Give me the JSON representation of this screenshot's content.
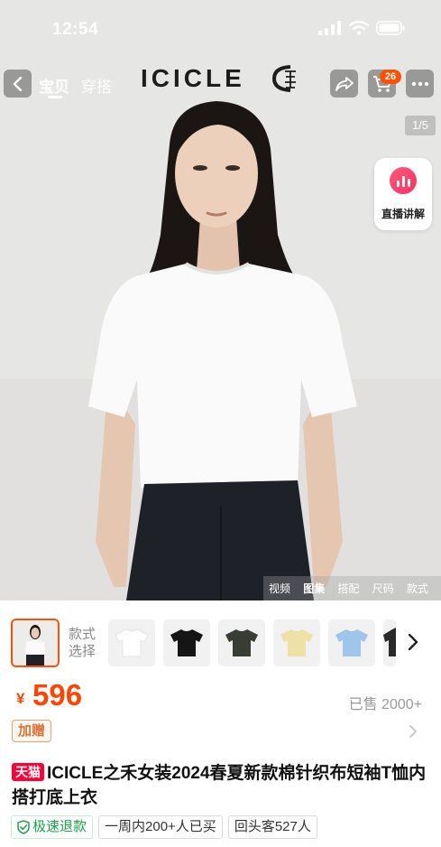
{
  "status_bar": {
    "time": "12:54"
  },
  "nav": {
    "tabs": [
      {
        "label": "宝贝",
        "active": true
      },
      {
        "label": "穿搭",
        "active": false
      }
    ],
    "brand": "ICICLE",
    "cart_badge": "26",
    "icons": [
      "back-icon",
      "share-icon",
      "cart-icon",
      "more-icon"
    ]
  },
  "gallery": {
    "page_indicator": "1/5",
    "live_label": "直播讲解",
    "media_tabs": [
      {
        "label": "视频",
        "active": false
      },
      {
        "label": "图集",
        "active": true
      },
      {
        "label": "搭配",
        "active": false
      },
      {
        "label": "尺码",
        "active": false
      },
      {
        "label": "款式",
        "active": false
      }
    ]
  },
  "variants": {
    "label": "款式\n选择",
    "swatches": [
      {
        "name": "white",
        "color": "#ffffff"
      },
      {
        "name": "black",
        "color": "#151515"
      },
      {
        "name": "dark-green",
        "color": "#3a3d34"
      },
      {
        "name": "yellow",
        "color": "#efe1a6"
      },
      {
        "name": "blue",
        "color": "#9fc5ea"
      }
    ]
  },
  "price": {
    "currency": "¥",
    "amount": "596",
    "sold": "已售 2000+",
    "redeem": "加赠"
  },
  "product": {
    "store_tag": "天猫",
    "title": "ICICLE之禾女装2024春夏新款棉针织布短袖T恤内搭打底上衣"
  },
  "tags": [
    {
      "label": "极速退款",
      "icon": "shield-check-icon"
    },
    {
      "label": "一周内200+人已买"
    },
    {
      "label": "回头客527人"
    }
  ],
  "colors": {
    "accent": "#ff5000",
    "price": "#ff4400",
    "tmall": "#ff0036",
    "fast_refund": "#1aa34a"
  }
}
